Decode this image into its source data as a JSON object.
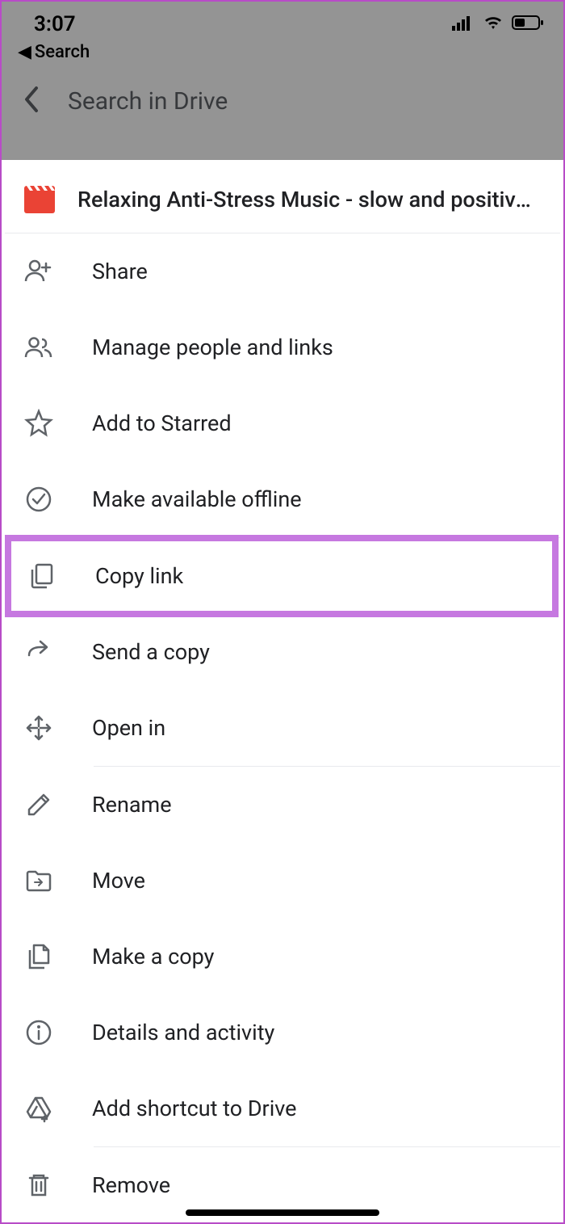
{
  "status": {
    "time": "3:07",
    "back_label": "Search"
  },
  "search": {
    "placeholder": "Search in Drive"
  },
  "file": {
    "title": "Relaxing Anti-Stress Music - slow and positive - rd..."
  },
  "menu": {
    "share": "Share",
    "manage": "Manage people and links",
    "star": "Add to Starred",
    "offline": "Make available offline",
    "copylink": "Copy link",
    "sendcopy": "Send a copy",
    "openin": "Open in",
    "rename": "Rename",
    "move": "Move",
    "makecopy": "Make a copy",
    "details": "Details and activity",
    "shortcut": "Add shortcut to Drive",
    "remove": "Remove"
  }
}
